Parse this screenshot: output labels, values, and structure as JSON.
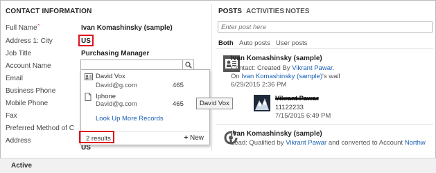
{
  "contact": {
    "section_title": "CONTACT INFORMATION",
    "labels": {
      "full_name": "Full Name",
      "address_city": "Address 1: City",
      "job_title": "Job Title",
      "account_name": "Account Name",
      "email": "Email",
      "business_phone": "Business Phone",
      "mobile_phone": "Mobile Phone",
      "fax": "Fax",
      "preferred_method": "Preferred Method of C",
      "address": "Address"
    },
    "required_mark": "*",
    "values": {
      "full_name": "Ivan Komashinsky (sample)",
      "address_city": "US",
      "job_title": "Purchasing Manager",
      "address": "US"
    }
  },
  "lookup": {
    "search_icon": "search-icon",
    "results": [
      {
        "name": "David Vox",
        "email": "David@g.com",
        "phone": "465",
        "icon": "contact-card-icon"
      },
      {
        "name": "Iphone",
        "email": "David@g.com",
        "phone": "465",
        "icon": "document-icon"
      }
    ],
    "more_records": "Look Up More Records",
    "result_count": "2 results",
    "new_label": "New",
    "new_icon": "+"
  },
  "tooltip": "David Vox",
  "social": {
    "tabs": [
      "POSTS",
      "ACTIVITIES",
      "NOTES"
    ],
    "post_placeholder": "Enter post here",
    "filters": [
      "Both",
      "Auto posts",
      "User posts"
    ],
    "posts": [
      {
        "title": "Ivan Komashinsky (sample)",
        "line1_prefix": "Contact: Created By ",
        "line1_link": "Vikrant Pawar",
        "line1_suffix": ".",
        "line2_prefix": "On ",
        "line2_link": "Ivan Komashinsky (sample)",
        "line2_suffix": "'s wall",
        "date": "6/29/2015 2:36 PM"
      },
      {
        "author": "Vikrant Pawar",
        "text": "11122233",
        "date": "7/15/2015 6:49 PM"
      },
      {
        "title": "Ivan Komashinsky (sample)",
        "line1_prefix": "Lead: Qualified by ",
        "line1_link": "Vikrant Pawar",
        "line1_suffix": " and converted to Account ",
        "line1_link2": "Northw"
      }
    ]
  },
  "status": "Active",
  "colors": {
    "highlight": "#e0101e",
    "link": "#1a5fb4"
  }
}
